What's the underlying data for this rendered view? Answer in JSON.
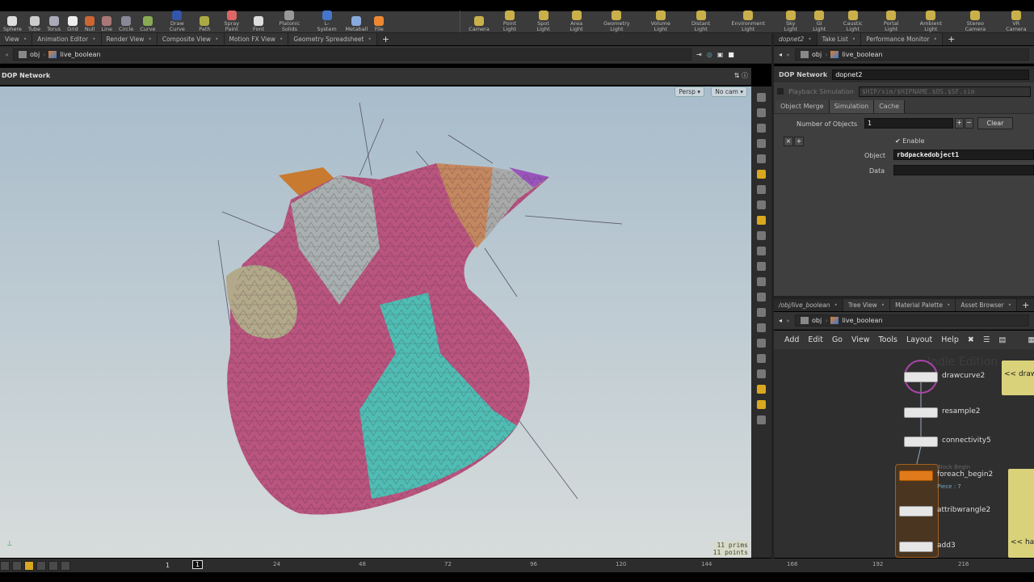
{
  "shelf": {
    "left_tools": [
      "Sphere",
      "Tube",
      "Torus",
      "Grid",
      "Null",
      "Line",
      "Circle",
      "Curve",
      "Draw Curve",
      "Path",
      "Spray Paint",
      "Font",
      "Platonic Solids",
      "L-System",
      "Metaball",
      "File"
    ],
    "right_tools": [
      "Camera",
      "Point Light",
      "Spot Light",
      "Area Light",
      "Geometry Light",
      "Volume Light",
      "Distant Light",
      "Environment Light",
      "Sky Light",
      "GI Light",
      "Caustic Light",
      "Portal Light",
      "Ambient Light",
      "Stereo Camera",
      "VR Camera"
    ]
  },
  "left_tabs": [
    "View",
    "Animation Editor",
    "Render View",
    "Composite View",
    "Motion FX View",
    "Geometry Spreadsheet"
  ],
  "path": {
    "root": "obj",
    "node": "live_boolean"
  },
  "viewport": {
    "title": "DOP Network",
    "persp": "Persp ▾",
    "cam": "No cam ▾",
    "prims": "11  prims",
    "points": "11 points"
  },
  "right_tabs": [
    "dopnet2",
    "Take List",
    "Performance Monitor"
  ],
  "params": {
    "type": "DOP Network",
    "name": "dopnet2",
    "playback": "Playback Simulation",
    "sim_path": "$HIP/sim/$HIPNAME.$OS.$SF.sim",
    "tabs": [
      "Object Merge",
      "Simulation",
      "Cache"
    ],
    "num_objects_label": "Number of Objects",
    "num_objects": "1",
    "clear": "Clear",
    "enable": "Enable",
    "object_label": "Object",
    "object": "rbdpackedobject1",
    "data_label": "Data",
    "data": ""
  },
  "net_tabs": [
    "/obj/live_boolean",
    "Tree View",
    "Material Palette",
    "Asset Browser"
  ],
  "net_menu": [
    "Add",
    "Edit",
    "Go",
    "View",
    "Tools",
    "Layout",
    "Help"
  ],
  "network": {
    "watermark": "Indie Edition",
    "nodes": [
      "drawcurve2",
      "resample2",
      "connectivity5",
      "foreach_begin2",
      "attribwrangle2",
      "add3"
    ],
    "block_label": "Block Begin",
    "piece": "Piece : 7",
    "sticky1": "<< draw y",
    "sticky2": "<< hand"
  },
  "timeline": {
    "frame": "1",
    "start": "1",
    "ticks": [
      "24",
      "48",
      "72",
      "96",
      "120",
      "144",
      "168",
      "192",
      "216"
    ]
  }
}
